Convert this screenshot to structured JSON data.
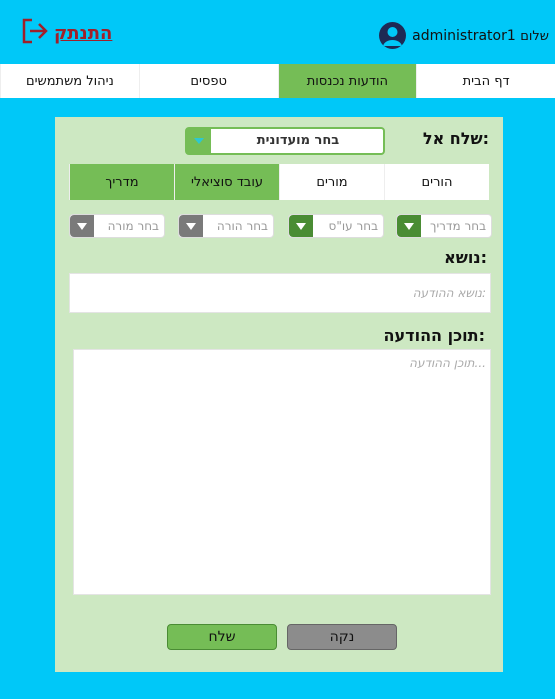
{
  "header": {
    "logout_label": "התנתק",
    "user_name": "administrator1",
    "greeting": "שלום"
  },
  "nav": {
    "items": [
      "דף הבית",
      "הודעות נכנסות",
      "טפסים",
      "ניהול משתמשים"
    ],
    "active_index": 1
  },
  "form": {
    "send_to_label": "שלח אל:",
    "club_select_value": "בחר מועדונית",
    "tabs": [
      "הורים",
      "מורים",
      "עובד סוציאלי",
      "מדריך"
    ],
    "active_tabs": [
      2,
      3
    ],
    "selects": [
      {
        "label": "בחר מדריך",
        "active": true
      },
      {
        "label": "בחר עו\"ס",
        "active": true
      },
      {
        "label": "בחר הורה",
        "active": false
      },
      {
        "label": "בחר מורה",
        "active": false
      }
    ],
    "subject_label": "נושא:",
    "subject_placeholder": "נושא ההודעה:",
    "content_label": "תוכן ההודעה:",
    "content_placeholder": "תוכן ההודעה...",
    "send_button": "שלח",
    "clear_button": "נקה"
  },
  "colors": {
    "background": "#00c8f8",
    "panel": "#cde8c2",
    "accent_green": "#75bd56",
    "logout_red": "#a0202a"
  },
  "icons": {
    "logout": "logout-icon",
    "avatar": "user-avatar-icon",
    "dropdown": "chevron-down-icon"
  }
}
